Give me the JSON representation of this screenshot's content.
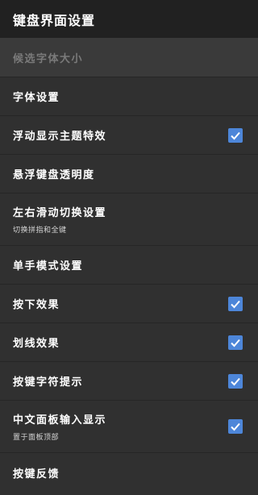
{
  "appbar": {
    "title": "键盘界面设置"
  },
  "items": [
    {
      "title": "候选字体大小",
      "summary": null,
      "checked": null,
      "enabled": false
    },
    {
      "title": "字体设置",
      "summary": null,
      "checked": null,
      "enabled": true
    },
    {
      "title": "浮动显示主题特效",
      "summary": null,
      "checked": true,
      "enabled": true
    },
    {
      "title": "悬浮键盘透明度",
      "summary": null,
      "checked": null,
      "enabled": true
    },
    {
      "title": "左右滑动切换设置",
      "summary": "切换拼指和全键",
      "checked": null,
      "enabled": true
    },
    {
      "title": "单手模式设置",
      "summary": null,
      "checked": null,
      "enabled": true
    },
    {
      "title": "按下效果",
      "summary": null,
      "checked": true,
      "enabled": true
    },
    {
      "title": "划线效果",
      "summary": null,
      "checked": true,
      "enabled": true
    },
    {
      "title": "按键字符提示",
      "summary": null,
      "checked": true,
      "enabled": true
    },
    {
      "title": "中文面板输入显示",
      "summary": "置于面板顶部",
      "checked": true,
      "enabled": true
    },
    {
      "title": "按键反馈",
      "summary": null,
      "checked": null,
      "enabled": true
    }
  ]
}
